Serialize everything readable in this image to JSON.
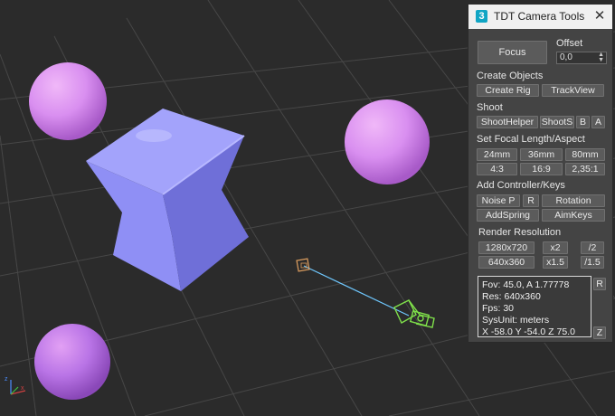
{
  "window": {
    "title": "TDT Camera Tools",
    "app_icon_glyph": "3",
    "close_glyph": "✕"
  },
  "focus": {
    "button_label": "Focus",
    "offset_label": "Offset",
    "offset_value": "0,0"
  },
  "create_objects": {
    "label": "Create Objects",
    "buttons": [
      "Create Rig",
      "TrackView"
    ]
  },
  "shoot": {
    "label": "Shoot",
    "buttons": [
      "ShootHelper",
      "ShootS",
      "B",
      "A"
    ]
  },
  "focal": {
    "label": "Set Focal Length/Aspect",
    "lengths": [
      "24mm",
      "36mm",
      "80mm"
    ],
    "aspects": [
      "4:3",
      "16:9",
      "2,35:1"
    ]
  },
  "controllers": {
    "label": "Add Controller/Keys",
    "row1": [
      "Noise P",
      "R",
      "Rotation"
    ],
    "row2": [
      "AddSpring",
      "AimKeys"
    ]
  },
  "render_resolution": {
    "label": "Render Resolution",
    "row1": [
      "1280x720",
      "x2",
      "/2"
    ],
    "row2": [
      "640x360",
      "x1.5",
      "/1.5"
    ]
  },
  "info": {
    "lines": [
      "Fov: 45.0, A 1.77778",
      "Res: 640x360",
      "Fps: 30",
      "SysUnit: meters",
      "X -58.0  Y -54.0  Z 75.0"
    ],
    "r_button": "R",
    "z_button": "Z"
  },
  "colors": {
    "viewport_bg": "#2b2b2b",
    "grid": "#474747",
    "box": "#8f8ff5",
    "sphere": "#d98ff0",
    "camera": "#7fe04a",
    "target": "#e0a060",
    "cam_line": "#6fc8ff"
  },
  "icons": [
    "close-icon",
    "spinner-icon",
    "camera-icon",
    "camera-target-icon",
    "axis-gizmo-icon"
  ]
}
